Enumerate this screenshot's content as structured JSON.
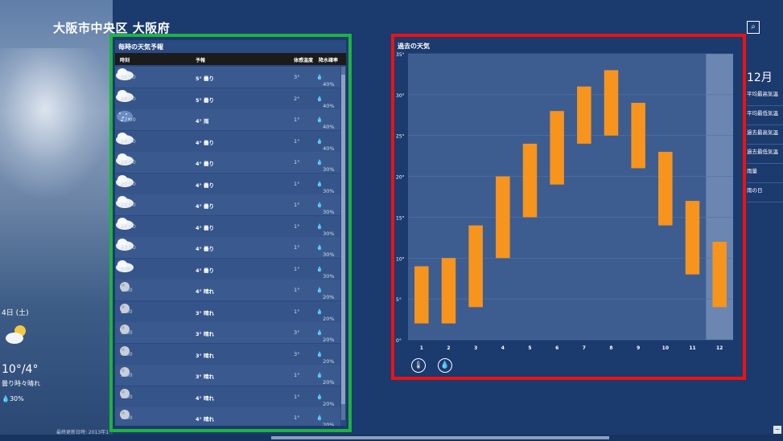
{
  "location": "大阪市中央区 大阪府",
  "today": {
    "date": "4日 (土)",
    "temp": "10°/4°",
    "condition": "曇り時々晴れ",
    "precip": "30%"
  },
  "last_updated": "最終更新日時: 2013年1",
  "hourly": {
    "title": "毎時の天気予報",
    "columns": [
      "時刻",
      "予報",
      "体感温度",
      "降水確率"
    ],
    "rows": [
      {
        "time": "15:00",
        "icon": "cloud",
        "condition": "5° 曇り",
        "feels": "3°",
        "precip": "40%"
      },
      {
        "time": "16:00",
        "icon": "cloud",
        "condition": "5° 曇り",
        "feels": "2°",
        "precip": "40%"
      },
      {
        "time": "17:00",
        "icon": "rain",
        "condition": "4° 雨",
        "feels": "1°",
        "precip": "40%"
      },
      {
        "time": "18:00",
        "icon": "cloud",
        "condition": "4° 曇り",
        "feels": "1°",
        "precip": "40%"
      },
      {
        "time": "19:00",
        "icon": "cloud",
        "condition": "4° 曇り",
        "feels": "1°",
        "precip": "30%"
      },
      {
        "time": "20:00",
        "icon": "cloud",
        "condition": "4° 曇り",
        "feels": "1°",
        "precip": "30%"
      },
      {
        "time": "21:00",
        "icon": "cloud",
        "condition": "4° 曇り",
        "feels": "1°",
        "precip": "30%"
      },
      {
        "time": "22:00",
        "icon": "cloud",
        "condition": "4° 曇り",
        "feels": "1°",
        "precip": "30%"
      },
      {
        "time": "23:00",
        "icon": "cloud",
        "condition": "4° 曇り",
        "feels": "1°",
        "precip": "30%"
      },
      {
        "time": "0:00",
        "icon": "cloud",
        "condition": "4° 曇り",
        "feels": "1°",
        "precip": "30%"
      },
      {
        "time": "1:00",
        "icon": "moon",
        "condition": "4° 晴れ",
        "feels": "1°",
        "precip": "20%"
      },
      {
        "time": "2:00",
        "icon": "moon",
        "condition": "3° 晴れ",
        "feels": "1°",
        "precip": "20%"
      },
      {
        "time": "3:00",
        "icon": "moon",
        "condition": "3° 晴れ",
        "feels": "3°",
        "precip": "20%"
      },
      {
        "time": "4:00",
        "icon": "moon",
        "condition": "3° 晴れ",
        "feels": "3°",
        "precip": "20%"
      },
      {
        "time": "5:00",
        "icon": "moon",
        "condition": "3° 晴れ",
        "feels": "1°",
        "precip": "20%"
      },
      {
        "time": "6:00",
        "icon": "moon",
        "condition": "4° 晴れ",
        "feels": "1°",
        "precip": "20%"
      },
      {
        "time": "7:00",
        "icon": "moon",
        "condition": "4° 晴れ",
        "feels": "1°",
        "precip": "20%"
      },
      {
        "time": "8:00",
        "icon": "sun",
        "condition": "4° 晴れ",
        "feels": "1°",
        "precip": "20%"
      }
    ]
  },
  "chart_data": {
    "type": "bar",
    "title": "過去の天気",
    "categories": [
      "1",
      "2",
      "3",
      "4",
      "5",
      "6",
      "7",
      "8",
      "9",
      "10",
      "11",
      "12"
    ],
    "series": [
      {
        "low": [
          2,
          2,
          4,
          10,
          15,
          19,
          24,
          25,
          21,
          14,
          8,
          4
        ],
        "high": [
          9,
          10,
          14,
          20,
          24,
          28,
          31,
          33,
          29,
          23,
          17,
          12
        ]
      }
    ],
    "y_ticks": [
      "0°",
      "5°",
      "10°",
      "15°",
      "20°",
      "25°",
      "30°",
      "35°"
    ],
    "ylim": [
      0,
      35
    ],
    "highlight_category": "12",
    "bar_color": "#f7941d"
  },
  "month_stats": {
    "month": "12月",
    "items": [
      "平均最高気温",
      "平均最低気温",
      "過去最高気温",
      "過去最低気温",
      "雨量",
      "雨の日"
    ]
  },
  "colors": {
    "background": "#1b3a6e",
    "highlight_green": "#1fb240",
    "highlight_red": "#ef1111"
  }
}
